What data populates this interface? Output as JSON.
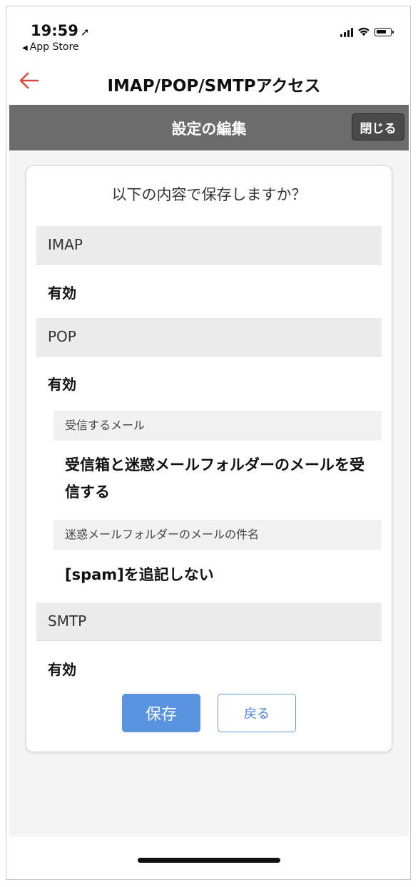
{
  "status_bar": {
    "time": "19:59",
    "location_glyph": "➚",
    "back_app": "App Store",
    "signal_bars": 4
  },
  "nav": {
    "title": "IMAP/POP/SMTPアクセス",
    "back_color": "#d94a3d"
  },
  "subheader": {
    "title": "設定の編集",
    "close_label": "閉じる"
  },
  "dialog": {
    "question": "以下の内容で保存しますか？",
    "imap": {
      "label": "IMAP",
      "value": "有効"
    },
    "pop": {
      "label": "POP",
      "value": "有効",
      "receive": {
        "label": "受信するメール",
        "value": "受信箱と迷惑メールフォルダーのメールを受信する"
      },
      "subject": {
        "label": "迷惑メールフォルダーのメールの件名",
        "value": "[spam]を追記しない"
      }
    },
    "smtp": {
      "label": "SMTP",
      "value": "有効"
    },
    "save_label": "保存",
    "back_label": "戻る"
  },
  "colors": {
    "header_gray": "#6c6c6c",
    "save_blue": "#5a93e0",
    "accent_red": "#d94a3d"
  }
}
